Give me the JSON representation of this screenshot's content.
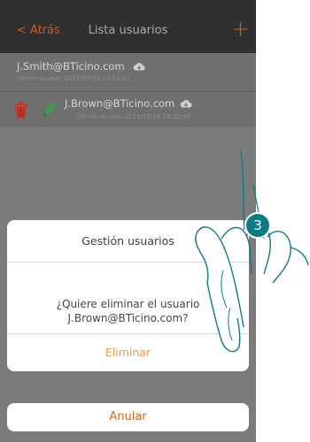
{
  "header": {
    "back_label": "< Atrás",
    "title": "Lista usuarios",
    "add_label": "+"
  },
  "users": [
    {
      "email": "J.Smith@BTicino.com",
      "last_access": "Último acceso: 2016/07/18  14:51:32",
      "icon": "cloud-icon"
    },
    {
      "email": "J.Brown@BTicino.com",
      "last_access": "Último acceso: 2016/10/18  16:22:46",
      "icon": "cloud-icon"
    }
  ],
  "row_actions": {
    "delete_icon": "trash-icon",
    "edit_icon": "pencil-icon"
  },
  "dialog": {
    "title": "Gestión usuarios",
    "message_line1": "¿Quiere eliminar el usuario",
    "message_line2": "J.Brown@BTicino.com?",
    "confirm_label": "Eliminar",
    "cancel_label": "Anular"
  },
  "step_badge": "3",
  "colors": {
    "accent": "#cf5a14",
    "header_bg": "#303030",
    "badge": "#0e7b82",
    "trash": "#c0392b",
    "pencil": "#3aa043"
  }
}
